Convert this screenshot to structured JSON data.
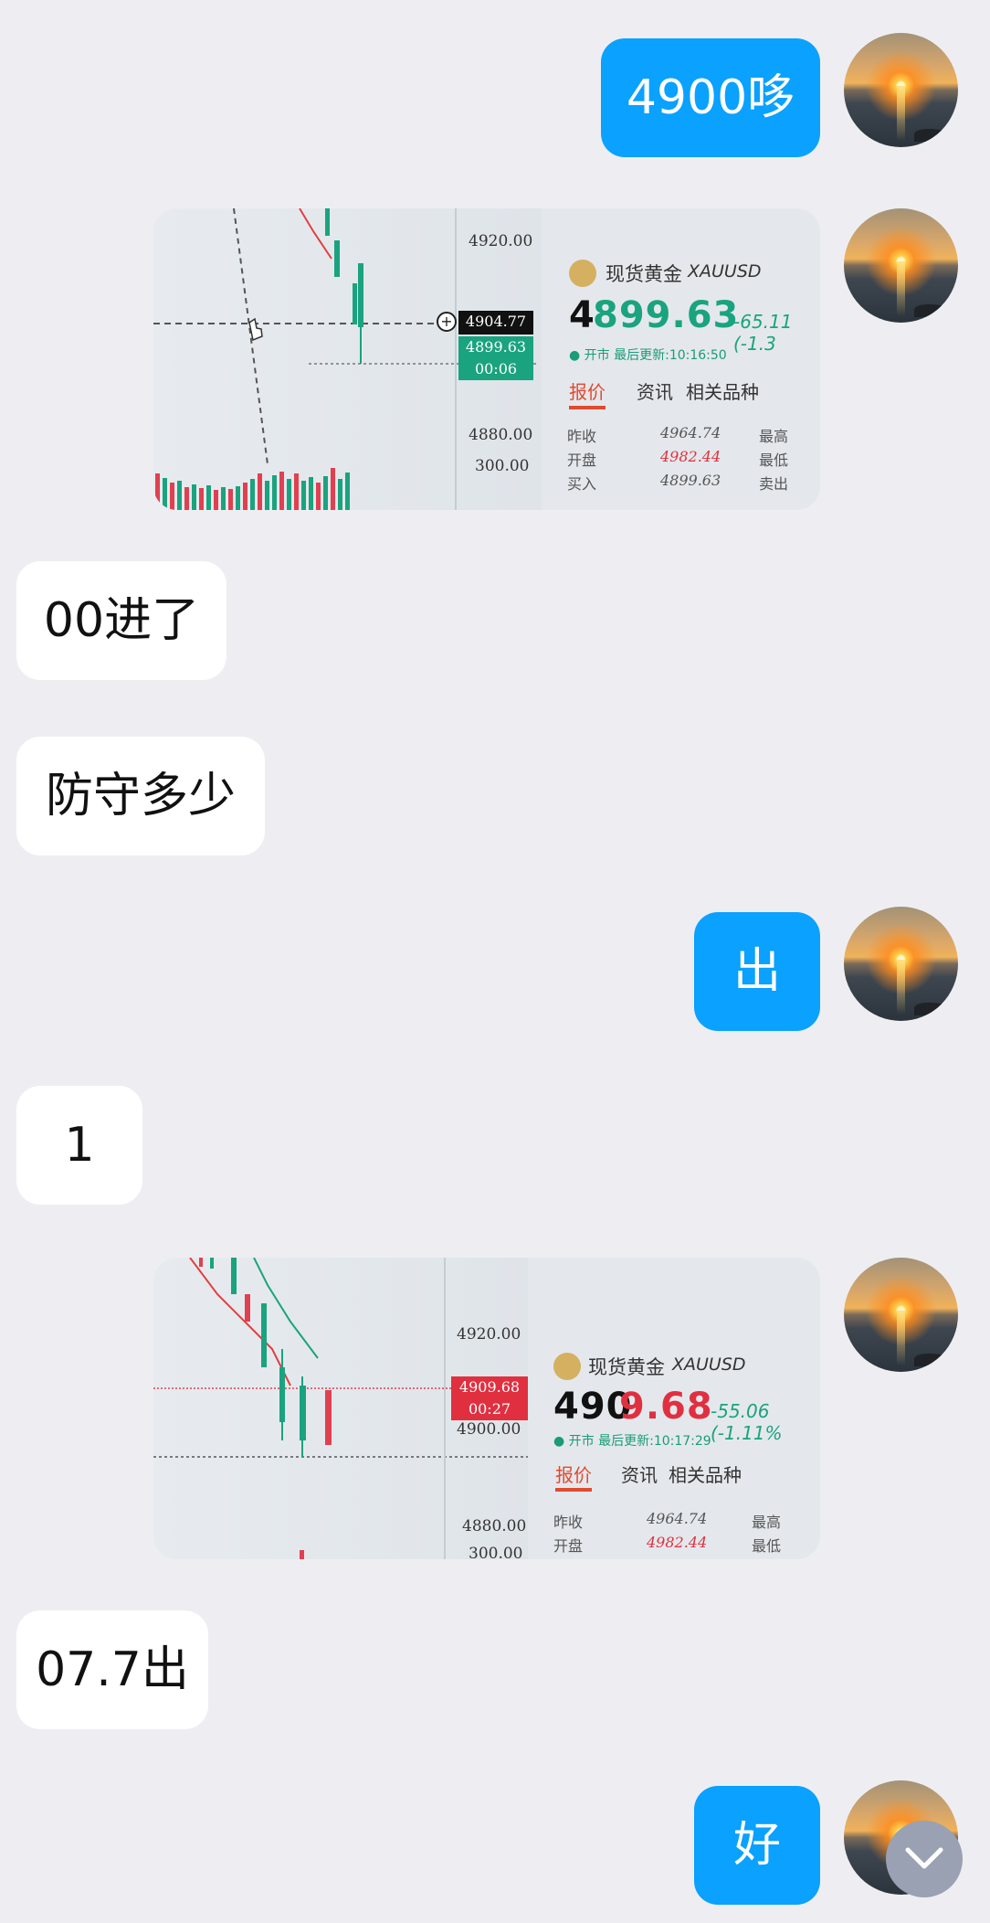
{
  "messages": [
    {
      "side": "right",
      "type": "text",
      "text": "4900哆"
    },
    {
      "side": "right",
      "type": "image",
      "screenshot": {
        "price_ticks": [
          "4920.00",
          "4880.00",
          "300.00"
        ],
        "crosshair_price": "4904.77",
        "current_price_tag": "4899.63",
        "countdown": "00:06",
        "name": "现货黄金",
        "symbol": "XAUUSD",
        "price_head": "4",
        "price_tail": "899.63",
        "change": "-65.11 (-1.3",
        "status": "● 开市 最后更新:10:16:50",
        "tabs": [
          "报价",
          "资讯",
          "相关品种"
        ],
        "rows": [
          {
            "label": "昨收",
            "value": "4964.74",
            "extra": "最高"
          },
          {
            "label": "开盘",
            "value": "4982.44",
            "extra": "最低"
          },
          {
            "label": "买入",
            "value": "4899.63",
            "extra": "卖出"
          }
        ]
      }
    },
    {
      "side": "left",
      "type": "text",
      "text": "00进了"
    },
    {
      "side": "left",
      "type": "text",
      "text": "防守多少"
    },
    {
      "side": "right",
      "type": "text",
      "text": "出"
    },
    {
      "side": "left",
      "type": "text",
      "text": "1"
    },
    {
      "side": "right",
      "type": "image",
      "screenshot": {
        "price_ticks": [
          "4920.00",
          "4900.00",
          "4880.00",
          "300.00"
        ],
        "current_price_tag": "4909.68",
        "countdown": "00:27",
        "name": "现货黄金",
        "symbol": "XAUUSD",
        "price_head": "490",
        "price_tail": "9.68",
        "change": "-55.06 (-1.11%",
        "status": "● 开市 最后更新:10:17:29",
        "tabs": [
          "报价",
          "资讯",
          "相关品种"
        ],
        "rows": [
          {
            "label": "昨收",
            "value": "4964.74",
            "extra": "最高"
          },
          {
            "label": "开盘",
            "value": "4982.44",
            "extra": "最低"
          }
        ]
      }
    },
    {
      "side": "left",
      "type": "text",
      "text": "07.7出"
    },
    {
      "side": "right",
      "type": "text",
      "text": "好"
    }
  ],
  "colors": {
    "outgoing_bubble": "#0aa1ff",
    "incoming_bubble": "#ffffff",
    "background": "#eeeef2",
    "price_up": "#1aa37f",
    "price_down": "#e03040"
  },
  "icons": {
    "scroll_down": "chevron-down-icon"
  }
}
